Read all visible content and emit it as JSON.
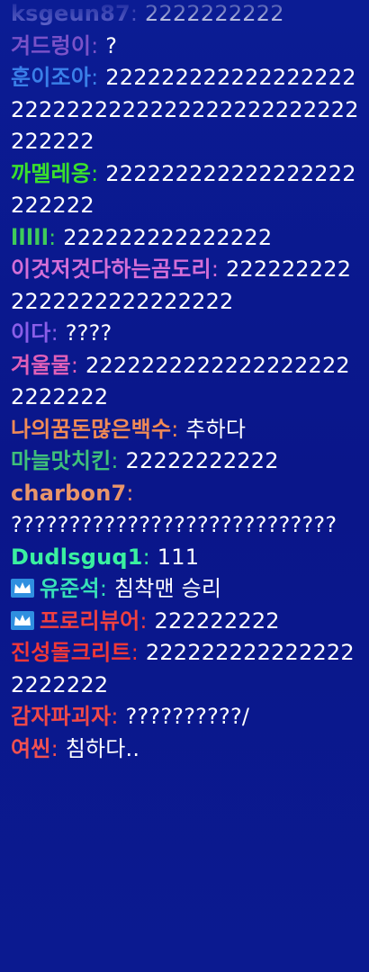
{
  "messages": [
    {
      "nick": "ksgeun87",
      "color": "#6d6fd0",
      "text": "2222222222",
      "badge": false
    },
    {
      "nick": "겨드렁이",
      "color": "#7a52c8",
      "text": "?",
      "badge": false
    },
    {
      "nick": "훈이조아",
      "color": "#3a7fe8",
      "text": "2222222222222222222222222222222222222222222222222",
      "badge": false
    },
    {
      "nick": "까멜레옹",
      "color": "#3ae02c",
      "text": "222222222222222222222222",
      "badge": false
    },
    {
      "nick": "lllll",
      "color": "#3ecb5a",
      "text": "222222222222222",
      "badge": false
    },
    {
      "nick": "이것저것다하는곰도리",
      "color": "#d46fd8",
      "text": "2222222222222222222222222",
      "badge": false
    },
    {
      "nick": "이다",
      "color": "#8a5ee8",
      "text": "????",
      "badge": false
    },
    {
      "nick": "겨울물",
      "color": "#e060b8",
      "text": "22222222222222222222222222",
      "badge": false
    },
    {
      "nick": "나의꿈돈많은백수",
      "color": "#f08a56",
      "text": "추하다",
      "badge": false
    },
    {
      "nick": "마늘맛치킨",
      "color": "#3fc07a",
      "text": "22222222222",
      "badge": false
    },
    {
      "nick": "charbon7",
      "color": "#e8956a",
      "text": "????????????????????????????",
      "badge": false
    },
    {
      "nick": "Dudlsguq1",
      "color": "#3af0a0",
      "text": "111",
      "badge": false
    },
    {
      "nick": "유준석",
      "color": "#38e0b8",
      "text": "침착맨 승리",
      "badge": true
    },
    {
      "nick": "프로리뷰어",
      "color": "#f04040",
      "text": "222222222",
      "badge": true
    },
    {
      "nick": "진성돌크리트",
      "color": "#f03838",
      "text": "2222222222222222222222",
      "badge": false
    },
    {
      "nick": "감자파괴자",
      "color": "#f04848",
      "text": "??????????/",
      "badge": false
    },
    {
      "nick": "여씬",
      "color": "#f05050",
      "text": "침하다..",
      "badge": false
    }
  ],
  "badge_color": "#2f8fe0",
  "badge_icon": "crown-icon"
}
